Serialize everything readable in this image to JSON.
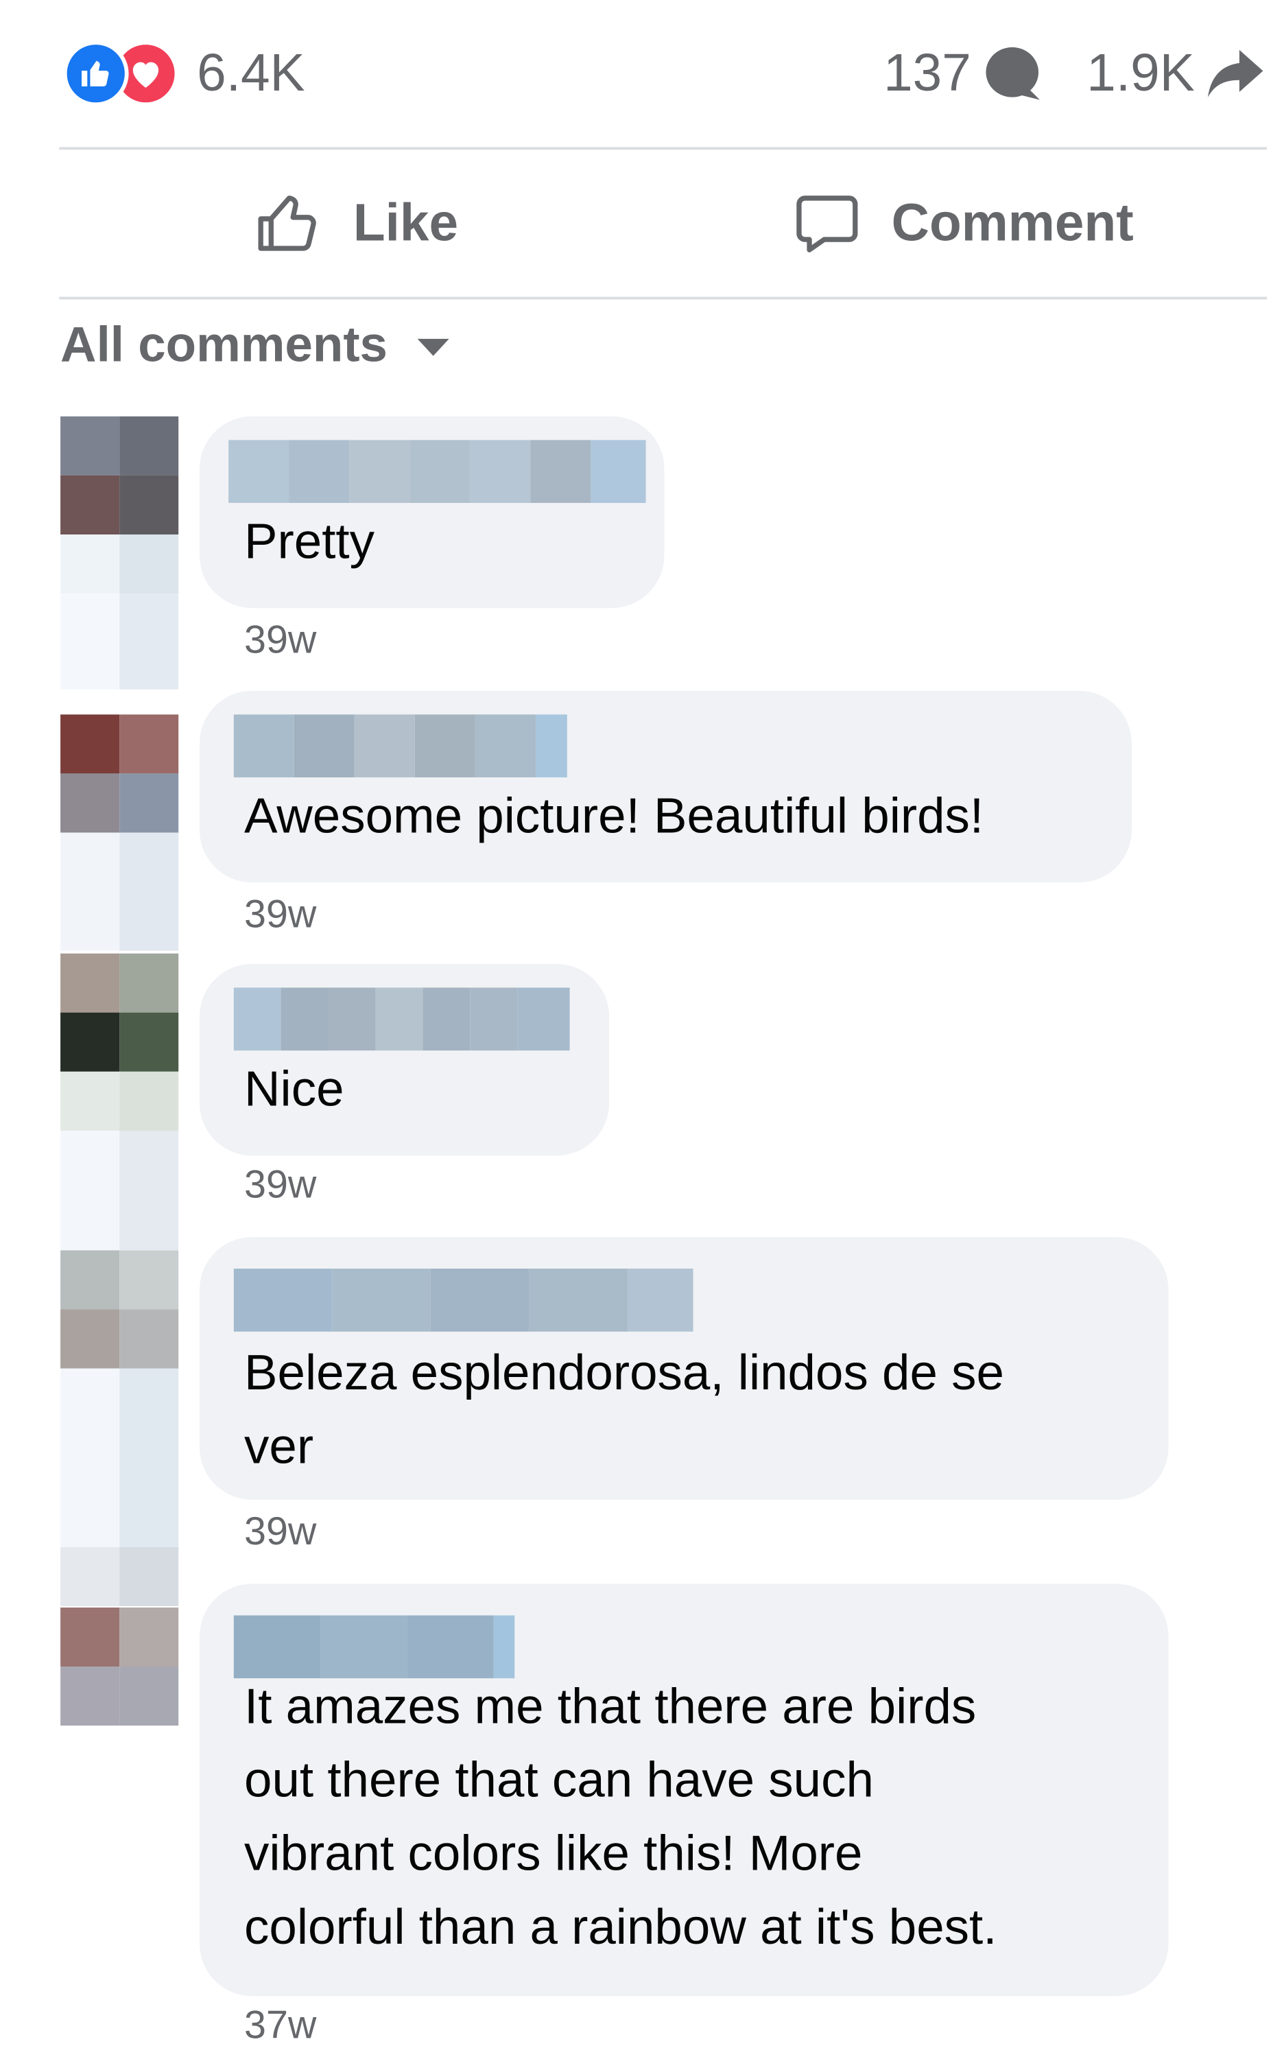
{
  "stats": {
    "reaction_count": "6.4K",
    "comment_count": "137",
    "share_count": "1.9K",
    "reaction_icons": [
      "like-icon",
      "love-icon"
    ]
  },
  "actions": {
    "like_label": "Like",
    "comment_label": "Comment"
  },
  "filter": {
    "label": "All comments"
  },
  "comments": [
    {
      "author": "",
      "text": "Pretty",
      "time": "39w"
    },
    {
      "author": "",
      "text": "Awesome picture! Beautiful birds!",
      "time": "39w"
    },
    {
      "author": "",
      "text": "Nice",
      "time": "39w"
    },
    {
      "author": "",
      "text": "Beleza esplendorosa, lindos de se\nver",
      "time": "39w"
    },
    {
      "author": "",
      "text": "It amazes me that there are birds\nout there that can have such\nvibrant colors like this! More\ncolorful than a rainbow at it's best.",
      "time": "37w"
    }
  ],
  "colors": {
    "like_blue": "#1877f2",
    "love_red": "#f33e58",
    "secondary_text": "#65676b",
    "bubble_bg": "#f0f2f5"
  }
}
